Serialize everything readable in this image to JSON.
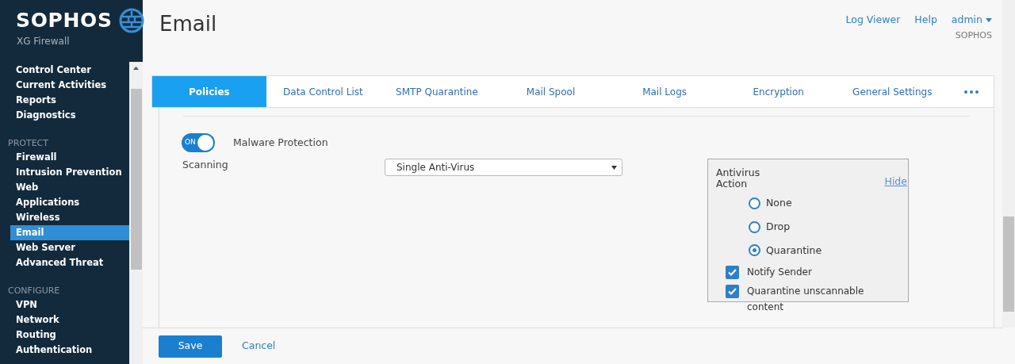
{
  "brand": {
    "name": "SOPHOS",
    "product": "XG Firewall"
  },
  "sidebar": {
    "groups": [
      {
        "items": [
          {
            "label": "Control Center",
            "selected": false
          },
          {
            "label": "Current Activities",
            "selected": false
          },
          {
            "label": "Reports",
            "selected": false
          },
          {
            "label": "Diagnostics",
            "selected": false
          }
        ]
      },
      {
        "heading": "PROTECT",
        "items": [
          {
            "label": "Firewall",
            "selected": false
          },
          {
            "label": "Intrusion Prevention",
            "selected": false
          },
          {
            "label": "Web",
            "selected": false
          },
          {
            "label": "Applications",
            "selected": false
          },
          {
            "label": "Wireless",
            "selected": false
          },
          {
            "label": "Email",
            "selected": true
          },
          {
            "label": "Web Server",
            "selected": false
          },
          {
            "label": "Advanced Threat",
            "selected": false
          }
        ]
      },
      {
        "heading": "CONFIGURE",
        "items": [
          {
            "label": "VPN",
            "selected": false
          },
          {
            "label": "Network",
            "selected": false
          },
          {
            "label": "Routing",
            "selected": false
          },
          {
            "label": "Authentication",
            "selected": false
          }
        ]
      }
    ]
  },
  "page_title": "Email",
  "header_links": [
    "Log Viewer",
    "Help"
  ],
  "user": {
    "name": "admin",
    "org": "SOPHOS"
  },
  "tabs": [
    {
      "label": "Policies",
      "selected": true
    },
    {
      "label": "Data Control List",
      "selected": false
    },
    {
      "label": "SMTP Quarantine",
      "selected": false
    },
    {
      "label": "Mail Spool",
      "selected": false
    },
    {
      "label": "Mail Logs",
      "selected": false
    },
    {
      "label": "Encryption",
      "selected": false
    },
    {
      "label": "General Settings",
      "selected": false
    }
  ],
  "toggle": {
    "on": true,
    "text": "ON",
    "label": "Malware Protection"
  },
  "scanning": {
    "label": "Scanning",
    "value": "Single Anti-Virus"
  },
  "antivirus": {
    "title": "Antivirus Action",
    "hide": "Hide",
    "options": [
      {
        "label": "None",
        "selected": false
      },
      {
        "label": "Drop",
        "selected": false
      },
      {
        "label": "Quarantine",
        "selected": true
      }
    ],
    "checkboxes": [
      {
        "label": "Notify Sender",
        "checked": true
      },
      {
        "label": "Quarantine unscannable content",
        "checked": true
      }
    ]
  },
  "buttons": {
    "save": "Save",
    "cancel": "Cancel"
  }
}
